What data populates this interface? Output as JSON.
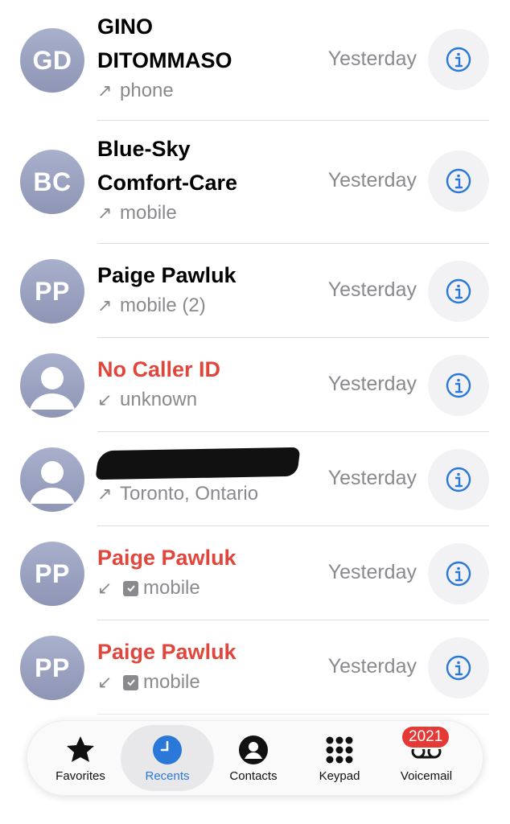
{
  "colors": {
    "missed": "#e0463c",
    "accent": "#2a78d8",
    "secondary_text": "#8a8a8e",
    "badge": "#e53935"
  },
  "calls": [
    {
      "avatar": "GD",
      "name_line1": "GINO",
      "name_line2": "DITOMMASO",
      "missed": false,
      "direction": "outgoing",
      "label": "phone",
      "time": "Yesterday"
    },
    {
      "avatar": "BC",
      "name_line1": "Blue-Sky",
      "name_line2": "Comfort-Care",
      "missed": false,
      "direction": "outgoing",
      "label": "mobile",
      "time": "Yesterday"
    },
    {
      "avatar": "PP",
      "name_line1": "Paige Pawluk",
      "missed": false,
      "direction": "outgoing",
      "label": "mobile (2)",
      "time": "Yesterday"
    },
    {
      "avatar_icon": "person-silhouette-icon",
      "name_line1": "No Caller ID",
      "missed": true,
      "direction": "incoming",
      "label": "unknown",
      "time": "Yesterday"
    },
    {
      "avatar_icon": "person-silhouette-icon",
      "name_redacted": true,
      "missed": false,
      "direction": "outgoing",
      "label": "Toronto, Ontario",
      "time": "Yesterday"
    },
    {
      "avatar": "PP",
      "name_line1": "Paige Pawluk",
      "missed": true,
      "direction": "incoming",
      "screened": true,
      "label": "mobile",
      "time": "Yesterday"
    },
    {
      "avatar": "PP",
      "name_line1": "Paige Pawluk",
      "missed": true,
      "direction": "incoming",
      "screened": true,
      "label": "mobile",
      "time": "Yesterday"
    }
  ],
  "arrows": {
    "outgoing": "↗",
    "incoming": "↙"
  },
  "tabs": [
    {
      "label": "Favorites",
      "icon": "star-icon"
    },
    {
      "label": "Recents",
      "icon": "clock-icon",
      "active": true
    },
    {
      "label": "Contacts",
      "icon": "person-circle-icon"
    },
    {
      "label": "Keypad",
      "icon": "keypad-icon"
    },
    {
      "label": "Voicemail",
      "icon": "voicemail-icon",
      "badge": "2021"
    }
  ]
}
